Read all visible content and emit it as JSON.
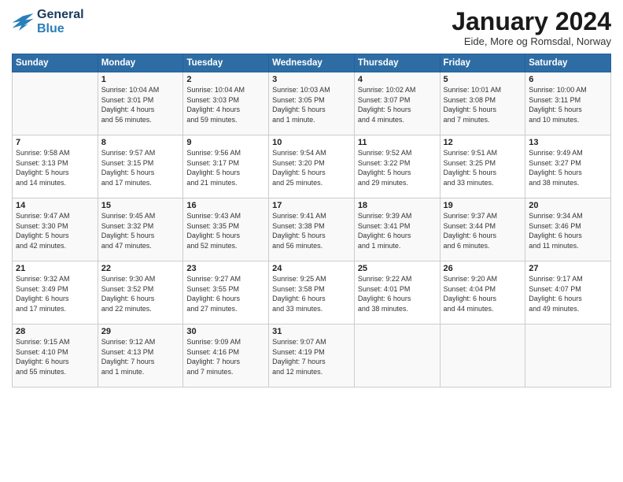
{
  "header": {
    "logo_line1": "General",
    "logo_line2": "Blue",
    "month_title": "January 2024",
    "subtitle": "Eide, More og Romsdal, Norway"
  },
  "weekdays": [
    "Sunday",
    "Monday",
    "Tuesday",
    "Wednesday",
    "Thursday",
    "Friday",
    "Saturday"
  ],
  "weeks": [
    [
      {
        "day": "",
        "info": ""
      },
      {
        "day": "1",
        "info": "Sunrise: 10:04 AM\nSunset: 3:01 PM\nDaylight: 4 hours\nand 56 minutes."
      },
      {
        "day": "2",
        "info": "Sunrise: 10:04 AM\nSunset: 3:03 PM\nDaylight: 4 hours\nand 59 minutes."
      },
      {
        "day": "3",
        "info": "Sunrise: 10:03 AM\nSunset: 3:05 PM\nDaylight: 5 hours\nand 1 minute."
      },
      {
        "day": "4",
        "info": "Sunrise: 10:02 AM\nSunset: 3:07 PM\nDaylight: 5 hours\nand 4 minutes."
      },
      {
        "day": "5",
        "info": "Sunrise: 10:01 AM\nSunset: 3:08 PM\nDaylight: 5 hours\nand 7 minutes."
      },
      {
        "day": "6",
        "info": "Sunrise: 10:00 AM\nSunset: 3:11 PM\nDaylight: 5 hours\nand 10 minutes."
      }
    ],
    [
      {
        "day": "7",
        "info": "Sunrise: 9:58 AM\nSunset: 3:13 PM\nDaylight: 5 hours\nand 14 minutes."
      },
      {
        "day": "8",
        "info": "Sunrise: 9:57 AM\nSunset: 3:15 PM\nDaylight: 5 hours\nand 17 minutes."
      },
      {
        "day": "9",
        "info": "Sunrise: 9:56 AM\nSunset: 3:17 PM\nDaylight: 5 hours\nand 21 minutes."
      },
      {
        "day": "10",
        "info": "Sunrise: 9:54 AM\nSunset: 3:20 PM\nDaylight: 5 hours\nand 25 minutes."
      },
      {
        "day": "11",
        "info": "Sunrise: 9:52 AM\nSunset: 3:22 PM\nDaylight: 5 hours\nand 29 minutes."
      },
      {
        "day": "12",
        "info": "Sunrise: 9:51 AM\nSunset: 3:25 PM\nDaylight: 5 hours\nand 33 minutes."
      },
      {
        "day": "13",
        "info": "Sunrise: 9:49 AM\nSunset: 3:27 PM\nDaylight: 5 hours\nand 38 minutes."
      }
    ],
    [
      {
        "day": "14",
        "info": "Sunrise: 9:47 AM\nSunset: 3:30 PM\nDaylight: 5 hours\nand 42 minutes."
      },
      {
        "day": "15",
        "info": "Sunrise: 9:45 AM\nSunset: 3:32 PM\nDaylight: 5 hours\nand 47 minutes."
      },
      {
        "day": "16",
        "info": "Sunrise: 9:43 AM\nSunset: 3:35 PM\nDaylight: 5 hours\nand 52 minutes."
      },
      {
        "day": "17",
        "info": "Sunrise: 9:41 AM\nSunset: 3:38 PM\nDaylight: 5 hours\nand 56 minutes."
      },
      {
        "day": "18",
        "info": "Sunrise: 9:39 AM\nSunset: 3:41 PM\nDaylight: 6 hours\nand 1 minute."
      },
      {
        "day": "19",
        "info": "Sunrise: 9:37 AM\nSunset: 3:44 PM\nDaylight: 6 hours\nand 6 minutes."
      },
      {
        "day": "20",
        "info": "Sunrise: 9:34 AM\nSunset: 3:46 PM\nDaylight: 6 hours\nand 11 minutes."
      }
    ],
    [
      {
        "day": "21",
        "info": "Sunrise: 9:32 AM\nSunset: 3:49 PM\nDaylight: 6 hours\nand 17 minutes."
      },
      {
        "day": "22",
        "info": "Sunrise: 9:30 AM\nSunset: 3:52 PM\nDaylight: 6 hours\nand 22 minutes."
      },
      {
        "day": "23",
        "info": "Sunrise: 9:27 AM\nSunset: 3:55 PM\nDaylight: 6 hours\nand 27 minutes."
      },
      {
        "day": "24",
        "info": "Sunrise: 9:25 AM\nSunset: 3:58 PM\nDaylight: 6 hours\nand 33 minutes."
      },
      {
        "day": "25",
        "info": "Sunrise: 9:22 AM\nSunset: 4:01 PM\nDaylight: 6 hours\nand 38 minutes."
      },
      {
        "day": "26",
        "info": "Sunrise: 9:20 AM\nSunset: 4:04 PM\nDaylight: 6 hours\nand 44 minutes."
      },
      {
        "day": "27",
        "info": "Sunrise: 9:17 AM\nSunset: 4:07 PM\nDaylight: 6 hours\nand 49 minutes."
      }
    ],
    [
      {
        "day": "28",
        "info": "Sunrise: 9:15 AM\nSunset: 4:10 PM\nDaylight: 6 hours\nand 55 minutes."
      },
      {
        "day": "29",
        "info": "Sunrise: 9:12 AM\nSunset: 4:13 PM\nDaylight: 7 hours\nand 1 minute."
      },
      {
        "day": "30",
        "info": "Sunrise: 9:09 AM\nSunset: 4:16 PM\nDaylight: 7 hours\nand 7 minutes."
      },
      {
        "day": "31",
        "info": "Sunrise: 9:07 AM\nSunset: 4:19 PM\nDaylight: 7 hours\nand 12 minutes."
      },
      {
        "day": "",
        "info": ""
      },
      {
        "day": "",
        "info": ""
      },
      {
        "day": "",
        "info": ""
      }
    ]
  ]
}
